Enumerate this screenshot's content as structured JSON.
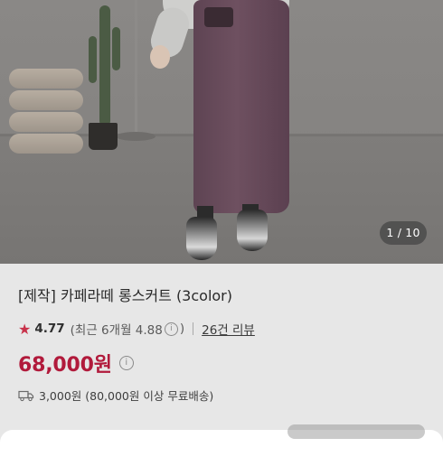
{
  "gallery": {
    "counter": "1 / 10"
  },
  "product": {
    "title": "[제작] 카페라떼 롱스커트 (3color)",
    "rating": "4.77",
    "recent_rating": "(최근 6개월 4.88",
    "recent_rating_close": ")",
    "review_count": "26건 리뷰",
    "price": "68,000원",
    "shipping": "3,000원 (80,000원 이상 무료배송)"
  },
  "icons": {
    "star": "star-icon",
    "info": "info-icon",
    "truck": "truck-icon"
  },
  "colors": {
    "price": "#b11a3b",
    "star": "#c8324a"
  }
}
